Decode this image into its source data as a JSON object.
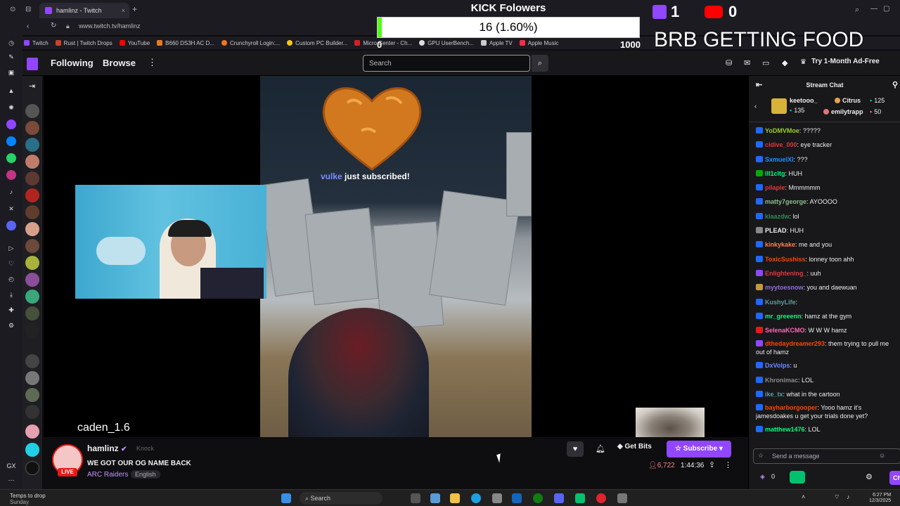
{
  "browser": {
    "tab_title": "hamlinz - Twitch",
    "url": "www.twitch.tv/hamlinz",
    "bookmarks": [
      "Twitch",
      "Rust | Twitch Drops",
      "YouTube",
      "B660 DS3H AC D...",
      "Crunchyroll Login:...",
      "Custom PC Builder...",
      "Micro Center - Ch...",
      "GPU UserBench...",
      "Apple TV",
      "Apple Music"
    ]
  },
  "overlay": {
    "kick_title": "KICK Folowers",
    "kick_count": "16 (1.60%)",
    "kick_min": "0",
    "kick_max": "1000",
    "kick_progress": 0.016,
    "twitch_count": "1",
    "youtube_count": "0",
    "brb": "BRB GETTING FOOD",
    "sub_alert_user": "vulke",
    "sub_alert_text": " just subscribed!",
    "cam_name": "caden_1.6"
  },
  "nav": {
    "following": "Following",
    "browse": "Browse",
    "search_placeholder": "Search",
    "adfree": "Try 1-Month Ad-Free"
  },
  "channel": {
    "name": "hamlinz",
    "knock": "Knock",
    "title": "WE GOT OUR OG NAME BACK",
    "game": "ARC Raiders",
    "language": "English",
    "live": "LIVE",
    "get_bits": "Get Bits",
    "subscribe": "Subscribe",
    "viewers": "6,722",
    "uptime": "1:44:36"
  },
  "chat": {
    "header": "Stream Chat",
    "gifts": [
      {
        "name": "keetooo_",
        "count": "135"
      },
      {
        "name": "Citrus",
        "count": "125"
      },
      {
        "name": "emilytrapp",
        "count": "50"
      }
    ],
    "messages": [
      {
        "user": "YoDMVMoe",
        "text": ": ?????",
        "color": "#9acd32"
      },
      {
        "user": "cidive_000",
        "text": ": eye tracker",
        "color": "#e0383e"
      },
      {
        "user": "SxmuelXl",
        "text": ": ???",
        "color": "#1e90ff"
      },
      {
        "user": "lll1cltg",
        "text": ": HUH",
        "color": "#00ff7f"
      },
      {
        "user": "pilapie",
        "text": ": Mmmmmm",
        "color": "#e0383e"
      },
      {
        "user": "matty7george",
        "text": ": AYOOOO",
        "color": "#8fbc8f"
      },
      {
        "user": "klaazdw",
        "text": ": lol",
        "color": "#2e8b57"
      },
      {
        "user": "PLEAD",
        "text": ": HUH",
        "color": "#efeff1"
      },
      {
        "user": "kinkykake",
        "text": ": me and you",
        "color": "#ff7f50"
      },
      {
        "user": "ToxicSushiss",
        "text": ": lonney toon ahh",
        "color": "#ff4500"
      },
      {
        "user": "Enlightening_",
        "text": ": uuh",
        "color": "#e0383e"
      },
      {
        "user": "myytoesnow",
        "text": ": you and daewuan",
        "color": "#9370db"
      },
      {
        "user": "KushyLife",
        "text": ":",
        "color": "#5f9ea0"
      },
      {
        "user": "mr_greeenn",
        "text": ": hamz at the gym",
        "color": "#00ff7f"
      },
      {
        "user": "SelenaKCMO",
        "text": ": W W W hamz",
        "color": "#ff69b4"
      },
      {
        "user": "dthedaydreamer293",
        "text": ": them trying to pull me out of hamz",
        "color": "#ff4500"
      },
      {
        "user": "DxVolps",
        "text": ": u",
        "color": "#6a8cff"
      },
      {
        "user": "Khronimac",
        "text": ": LOL",
        "color": "#8a8a8a"
      },
      {
        "user": "ike_tx",
        "text": ": what in the cartoon",
        "color": "#5f9ea0"
      },
      {
        "user": "bayharborgooper",
        "text": ": Yooo hamz it's jamesdoakes u get your trials done yet?",
        "color": "#ff4500"
      },
      {
        "user": "matthew1476",
        "text": ": LOL",
        "color": "#00ff7f"
      }
    ],
    "input_placeholder": "Send a message",
    "points": "0",
    "chat_button": "Chat"
  },
  "taskbar": {
    "weather_line1": "Temps to drop",
    "weather_line2": "Sunday",
    "search": "Search",
    "time": "6:27 PM",
    "date": "12/3/2025"
  }
}
